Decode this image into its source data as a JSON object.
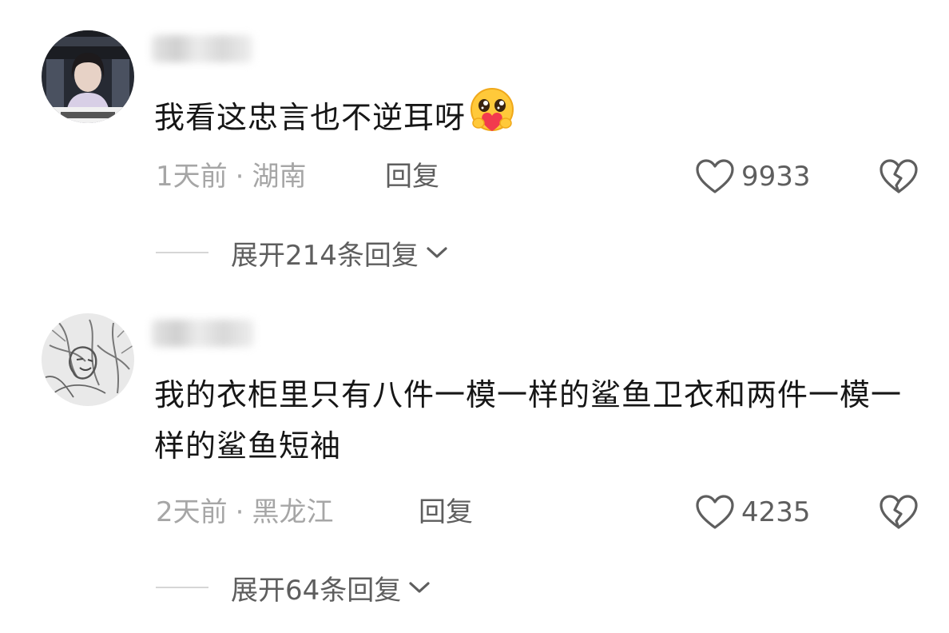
{
  "comments": [
    {
      "avatar_icon": "avatar-photo-portrait",
      "text": "我看这忠言也不逆耳呀",
      "emoji_icon": "hugging-heart-emoji",
      "time": "1天前",
      "separator": "·",
      "location": "湖南",
      "reply_label": "回复",
      "like_count": "9933",
      "expand_label": "展开214条回复"
    },
    {
      "avatar_icon": "avatar-sketch-portrait",
      "text": "我的衣柜里只有八件一模一样的鲨鱼卫衣和两件一模一样的鲨鱼短袖",
      "time": "2天前",
      "separator": "·",
      "location": "黑龙江",
      "reply_label": "回复",
      "like_count": "4235",
      "expand_label": "展开64条回复"
    }
  ],
  "icons": {
    "like": "heart-outline-icon",
    "dislike": "broken-heart-icon",
    "expand": "chevron-down-icon"
  },
  "colors": {
    "text_primary": "#161616",
    "text_meta": "#a6a6a6",
    "text_action": "#5e5e5e",
    "icon_stroke": "#5e5e5e"
  }
}
